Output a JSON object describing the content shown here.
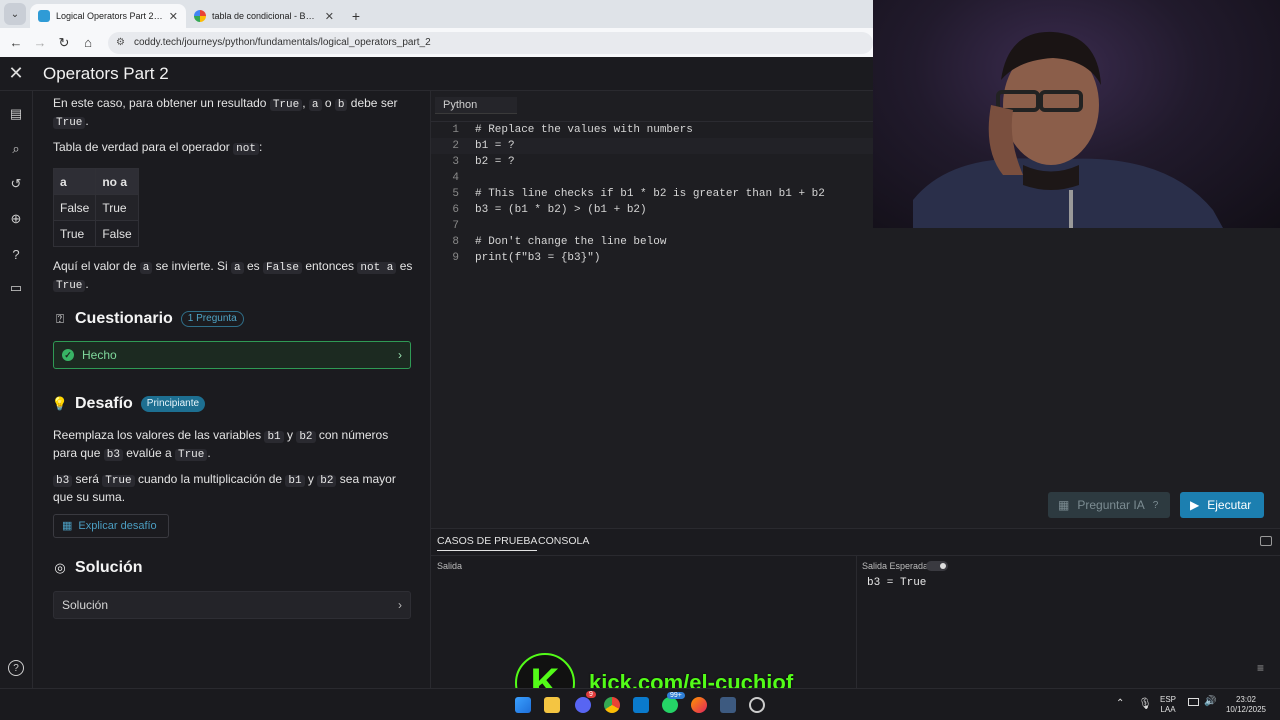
{
  "browser": {
    "tabs": [
      {
        "title": "Logical Operators Part 2 | Pytho",
        "active": true
      },
      {
        "title": "tabla de condicional - Buscar co",
        "active": false
      }
    ],
    "url": "coddy.tech/journeys/python/fundamentals/logical_operators_part_2"
  },
  "header": {
    "title": "Operators Part 2"
  },
  "lesson": {
    "p1": {
      "a": "En este caso, para obtener un resultado ",
      "c1": "True",
      "b": ", ",
      "c2": "a",
      "c": " o ",
      "c3": "b",
      "d": " debe ser ",
      "c4": "True",
      "e": "."
    },
    "p2": {
      "a": "Tabla de verdad para el operador ",
      "c1": "not",
      "b": ":"
    },
    "truth_table": {
      "headers": [
        "a",
        "no a"
      ],
      "rows": [
        [
          "False",
          "True"
        ],
        [
          "True",
          "False"
        ]
      ]
    },
    "p3": {
      "a": "Aquí el valor de ",
      "c1": "a",
      "b": " se invierte. Si ",
      "c2": "a",
      "c": " es ",
      "c3": "False",
      "d": " entonces ",
      "c4": "not a",
      "e": " es ",
      "c5": "True",
      "f": "."
    },
    "quiz": {
      "title": "Cuestionario",
      "badge": "1 Pregunta",
      "done_label": "Hecho"
    },
    "challenge": {
      "title": "Desafío",
      "badge": "Principiante",
      "p1": {
        "a": "Reemplaza los valores de las variables ",
        "c1": "b1",
        "b": " y ",
        "c2": "b2",
        "c": " con números para que ",
        "c3": "b3",
        "d": " evalúe a ",
        "c4": "True",
        "e": "."
      },
      "p2": {
        "c1": "b3",
        "a": " será ",
        "c2": "True",
        "b": " cuando la multiplicación de ",
        "c3": "b1",
        "c": " y ",
        "c4": "b2",
        "d": " sea mayor que su suma."
      },
      "explain_label": "Explicar desafío"
    },
    "solution": {
      "title": "Solución",
      "item_label": "Solución"
    }
  },
  "editor": {
    "language": "Python",
    "lines": [
      {
        "n": "1",
        "text": "# Replace the values with numbers"
      },
      {
        "n": "2",
        "text": "b1 = ?"
      },
      {
        "n": "3",
        "text": "b2 = ?"
      },
      {
        "n": "4",
        "text": ""
      },
      {
        "n": "5",
        "text": "# This line checks if b1 * b2 is greater than b1 + b2"
      },
      {
        "n": "6",
        "text": "b3 = (b1 * b2) > (b1 + b2)"
      },
      {
        "n": "7",
        "text": ""
      },
      {
        "n": "8",
        "text": "# Don't change the line below"
      },
      {
        "n": "9",
        "text": "print(f\"b3 = {b3}\")"
      }
    ],
    "ask_ai_label": "Preguntar IA",
    "run_label": "Ejecutar"
  },
  "bottom": {
    "tabs": [
      "CASOS DE PRUEBA",
      "CONSOLA"
    ],
    "output_label": "Salida",
    "expected_label": "Salida Esperada",
    "expected_value": "b3 = True"
  },
  "overlay": {
    "kick_url": "kick.com/el-cuchiof",
    "kick_letter": "K"
  },
  "taskbar": {
    "lang_top": "ESP",
    "lang_bottom": "LAA",
    "time": "23:02",
    "date": "10/12/2025",
    "discord_badge": "9",
    "whatsapp_badge": "99+"
  }
}
